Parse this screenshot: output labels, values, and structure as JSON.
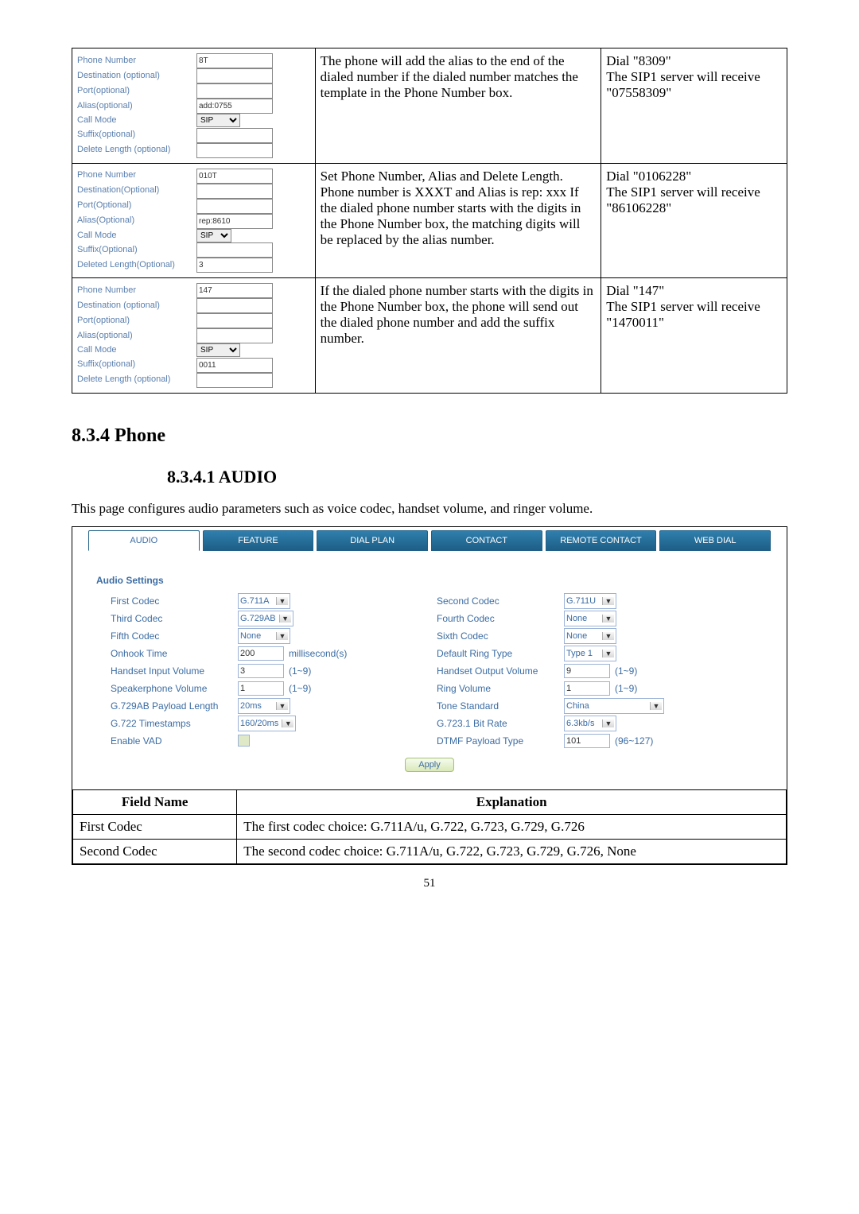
{
  "top_table": {
    "rows": [
      {
        "form": [
          {
            "label": "Phone Number",
            "value": "8T",
            "type": "input"
          },
          {
            "label": "Destination (optional)",
            "value": "",
            "type": "input"
          },
          {
            "label": "Port(optional)",
            "value": "",
            "type": "input"
          },
          {
            "label": "Alias(optional)",
            "value": "add:0755",
            "type": "input"
          },
          {
            "label": "Call Mode",
            "value": "SIP",
            "type": "select"
          },
          {
            "label": "Suffix(optional)",
            "value": "",
            "type": "input"
          },
          {
            "label": "Delete Length (optional)",
            "value": "",
            "type": "input"
          }
        ],
        "desc": "The phone will add the alias to the end of the dialed number if the dialed number matches the template in the Phone Number box.",
        "result": "Dial \"8309\"\nThe SIP1 server will receive \"07558309\""
      },
      {
        "form": [
          {
            "label": "Phone Number",
            "value": "010T",
            "type": "input"
          },
          {
            "label": "Destination(Optional)",
            "value": "",
            "type": "input"
          },
          {
            "label": "Port(Optional)",
            "value": "",
            "type": "input"
          },
          {
            "label": "Alias(Optional)",
            "value": "rep:8610",
            "type": "input"
          },
          {
            "label": "Call Mode",
            "value": "SIP",
            "type": "select_small"
          },
          {
            "label": "Suffix(Optional)",
            "value": "",
            "type": "input"
          },
          {
            "label": "Deleted Length(Optional)",
            "value": "3",
            "type": "input"
          }
        ],
        "desc": "Set Phone Number, Alias and Delete Length. Phone number is XXXT and Alias is rep: xxx If the dialed phone number starts with the digits in the Phone Number box, the matching digits will be replaced by the alias number.",
        "result": "Dial \"0106228\"\nThe SIP1 server will receive \"86106228\""
      },
      {
        "form": [
          {
            "label": "Phone Number",
            "value": "147",
            "type": "input"
          },
          {
            "label": "Destination (optional)",
            "value": "",
            "type": "input"
          },
          {
            "label": "Port(optional)",
            "value": "",
            "type": "input"
          },
          {
            "label": "Alias(optional)",
            "value": "",
            "type": "input"
          },
          {
            "label": "Call Mode",
            "value": "SIP",
            "type": "select"
          },
          {
            "label": "Suffix(optional)",
            "value": "0011",
            "type": "input"
          },
          {
            "label": "Delete Length (optional)",
            "value": "",
            "type": "input"
          }
        ],
        "desc": "If the dialed phone number starts with the digits in the Phone Number box, the phone will send out the dialed phone number and add the suffix number.",
        "result": "Dial \"147\"\nThe SIP1 server will receive \"1470011\""
      }
    ]
  },
  "heading_section": "8.3.4    Phone",
  "heading_sub": "8.3.4.1   AUDIO",
  "intro": "This page configures audio parameters such as voice codec, handset volume, and ringer volume.",
  "tabs": [
    "AUDIO",
    "FEATURE",
    "DIAL PLAN",
    "CONTACT",
    "REMOTE CONTACT",
    "WEB DIAL"
  ],
  "audio": {
    "title": "Audio Settings",
    "left": [
      {
        "label": "First Codec",
        "type": "select",
        "value": "G.711A"
      },
      {
        "label": "Third Codec",
        "type": "select",
        "value": "G.729AB"
      },
      {
        "label": "Fifth Codec",
        "type": "select",
        "value": "None"
      },
      {
        "label": "Onhook Time",
        "type": "input",
        "value": "200",
        "hint": "millisecond(s)"
      },
      {
        "label": "Handset Input Volume",
        "type": "input",
        "value": "3",
        "hint": "(1~9)"
      },
      {
        "label": "Speakerphone Volume",
        "type": "input",
        "value": "1",
        "hint": "(1~9)"
      },
      {
        "label": "G.729AB Payload Length",
        "type": "select",
        "value": "20ms"
      },
      {
        "label": "G.722 Timestamps",
        "type": "select",
        "value": "160/20ms"
      },
      {
        "label": "Enable VAD",
        "type": "check"
      }
    ],
    "right": [
      {
        "label": "Second Codec",
        "type": "select",
        "value": "G.711U"
      },
      {
        "label": "Fourth Codec",
        "type": "select",
        "value": "None"
      },
      {
        "label": "Sixth Codec",
        "type": "select",
        "value": "None"
      },
      {
        "label": "Default Ring Type",
        "type": "select",
        "value": "Type 1"
      },
      {
        "label": "Handset Output Volume",
        "type": "input",
        "value": "9",
        "hint": "(1~9)"
      },
      {
        "label": "Ring Volume",
        "type": "input",
        "value": "1",
        "hint": "(1~9)"
      },
      {
        "label": "Tone Standard",
        "type": "select",
        "value": "China",
        "wide": true
      },
      {
        "label": "G.723.1 Bit Rate",
        "type": "select",
        "value": "6.3kb/s"
      },
      {
        "label": "DTMF Payload Type",
        "type": "input",
        "value": "101",
        "hint": "(96~127)"
      }
    ],
    "apply": "Apply"
  },
  "exp_table": {
    "header": [
      "Field Name",
      "Explanation"
    ],
    "rows": [
      [
        "First Codec",
        "The first codec choice: G.711A/u, G.722, G.723, G.729, G.726"
      ],
      [
        "Second Codec",
        "The second codec choice: G.711A/u, G.722, G.723, G.729, G.726, None"
      ]
    ]
  },
  "page": "51"
}
